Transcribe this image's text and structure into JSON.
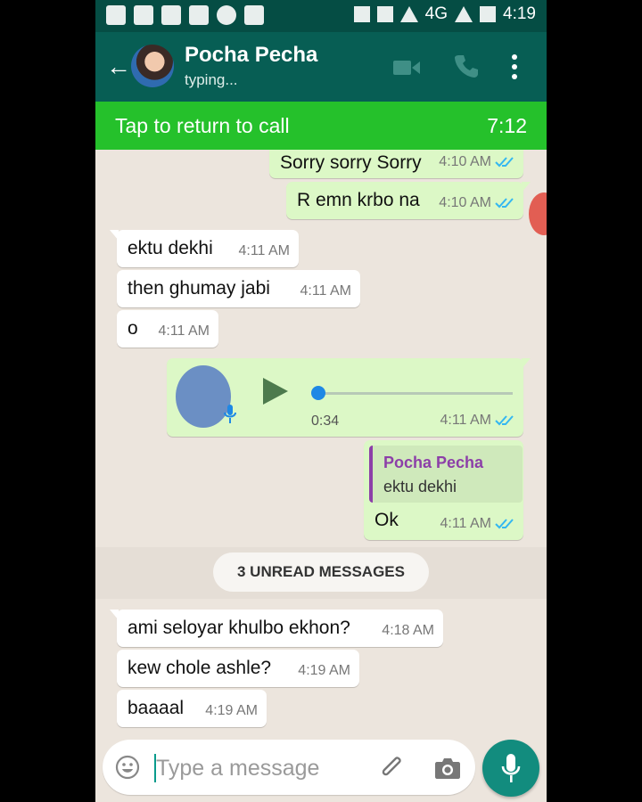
{
  "status_bar": {
    "network": "4G",
    "time": "4:19"
  },
  "header": {
    "name": "Pocha Pecha",
    "status": "typing..."
  },
  "call_banner": {
    "text": "Tap to return to call",
    "duration": "7:12"
  },
  "messages": [
    {
      "dir": "out",
      "text": "Sorry sorry Sorry",
      "time": "4:10 AM"
    },
    {
      "dir": "out",
      "text": "R emn krbo na",
      "time": "4:10 AM"
    },
    {
      "dir": "in",
      "text": "ektu dekhi",
      "time": "4:11 AM"
    },
    {
      "dir": "in",
      "text": "then ghumay jabi",
      "time": "4:11 AM"
    },
    {
      "dir": "in",
      "text": "o",
      "time": "4:11 AM"
    }
  ],
  "voice_message": {
    "duration": "0:34",
    "time": "4:11 AM",
    "progress": 0
  },
  "reply_message": {
    "quoted_name": "Pocha Pecha",
    "quoted_text": "ektu dekhi",
    "text": "Ok",
    "time": "4:11 AM"
  },
  "unread_label": "3 UNREAD MESSAGES",
  "unread_messages": [
    {
      "text": "ami seloyar khulbo ekhon?",
      "time": "4:18 AM"
    },
    {
      "text": "kew chole ashle?",
      "time": "4:19 AM"
    },
    {
      "text": "baaaal",
      "time": "4:19 AM"
    }
  ],
  "input": {
    "placeholder": "Type a message"
  },
  "icons": {
    "back": "arrow-left-icon",
    "video": "video-call-icon",
    "call": "phone-icon",
    "menu": "more-vert-icon",
    "emoji": "emoji-icon",
    "attach": "paperclip-icon",
    "camera": "camera-icon",
    "mic": "mic-icon",
    "read": "double-check-icon"
  },
  "colors": {
    "header": "#075e54",
    "call_banner": "#25c12b",
    "outgoing": "#dcf8c6",
    "incoming": "#ffffff",
    "accent": "#128c7e",
    "ticks": "#34b7f1"
  }
}
